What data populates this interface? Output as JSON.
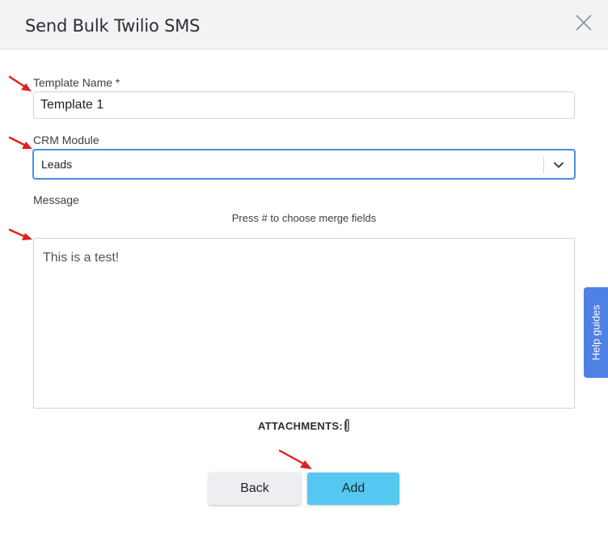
{
  "dialog": {
    "title": "Send Bulk Twilio SMS",
    "close_icon": "close-icon"
  },
  "form": {
    "template_name": {
      "label": "Template Name *",
      "value": "Template 1"
    },
    "crm_module": {
      "label": "CRM Module",
      "value": "Leads",
      "icon": "chevron-down-icon"
    },
    "message": {
      "label": "Message",
      "hint": "Press # to choose merge fields",
      "value": "This is a test!"
    },
    "attachments": {
      "label": "ATTACHMENTS:",
      "icon": "paperclip-icon"
    }
  },
  "buttons": {
    "back": "Back",
    "add": "Add"
  },
  "help_tab": {
    "label": "Help guides"
  },
  "colors": {
    "accent_blue": "#4a8ee6",
    "add_button": "#55c7f0",
    "help_tab": "#4f80e3",
    "annotation_arrow": "#e02020"
  }
}
